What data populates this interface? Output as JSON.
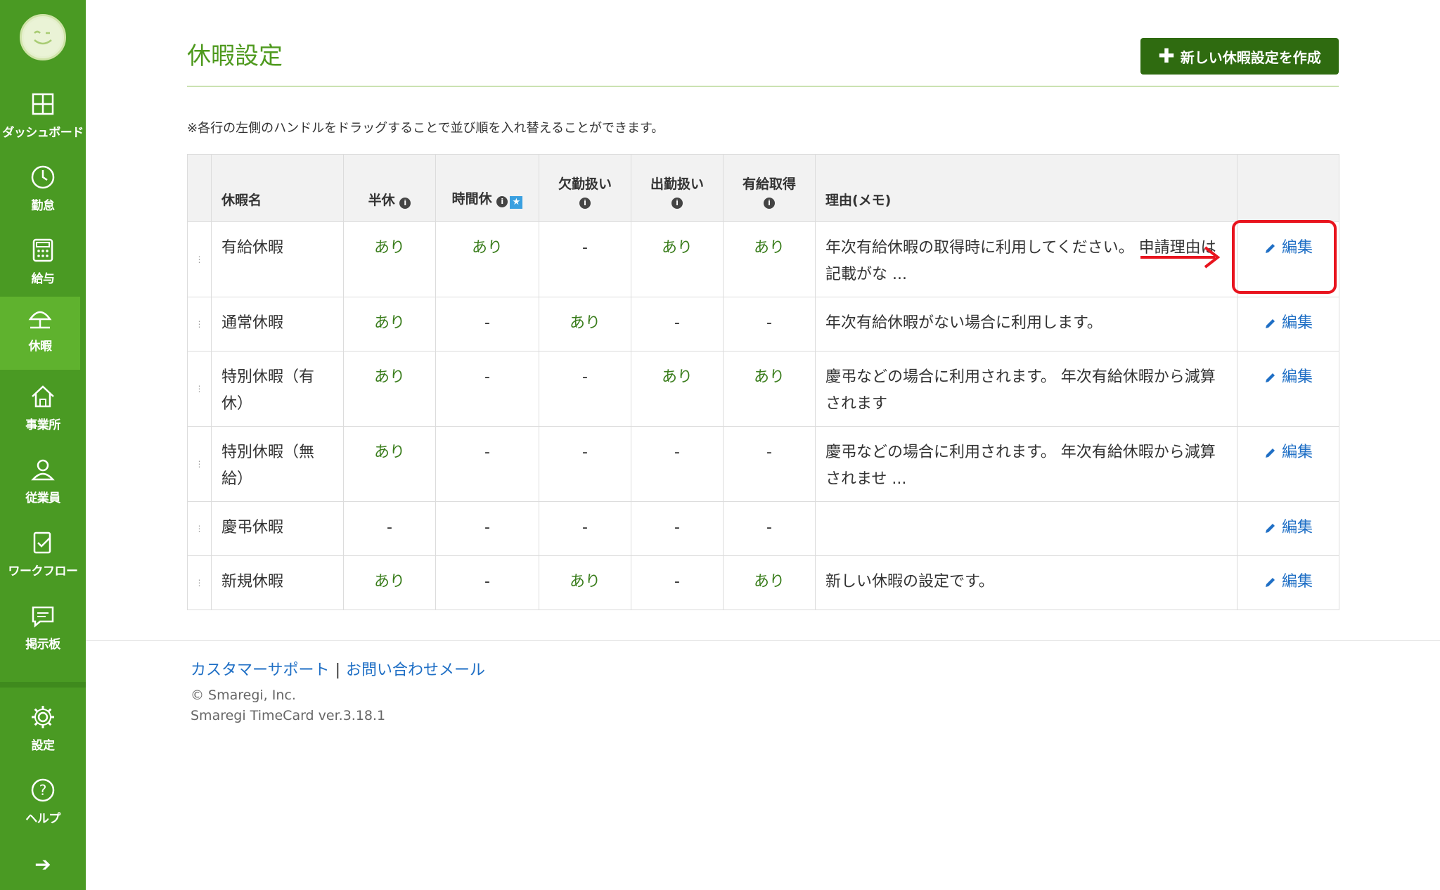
{
  "sidebar": {
    "items": [
      {
        "label": "ダッシュボード",
        "icon": "dashboard-icon"
      },
      {
        "label": "勤怠",
        "icon": "clock-icon"
      },
      {
        "label": "給与",
        "icon": "calculator-icon"
      },
      {
        "label": "休暇",
        "icon": "umbrella-icon",
        "active": true
      },
      {
        "label": "事業所",
        "icon": "home-icon"
      },
      {
        "label": "従業員",
        "icon": "person-icon"
      },
      {
        "label": "ワークフロー",
        "icon": "clipboard-check-icon"
      },
      {
        "label": "掲示板",
        "icon": "message-icon"
      },
      {
        "label": "設定",
        "icon": "gear-icon"
      },
      {
        "label": "ヘルプ",
        "icon": "question-icon"
      }
    ],
    "collapse_icon": "arrow-right-icon",
    "colors": {
      "bg": "#4a9a23",
      "active": "#5fb22e"
    }
  },
  "header": {
    "title": "休暇設定",
    "create_button": "新しい休暇設定を作成"
  },
  "note": "※各行の左側のハンドルをドラッグすることで並び順を入れ替えることができます。",
  "table": {
    "headers": {
      "name": "休暇名",
      "half": "半休",
      "hourly": "時間休",
      "absence": "欠勤扱い",
      "attendance": "出勤扱い",
      "paid": "有給取得",
      "memo": "理由(メモ)"
    },
    "edit_label": "編集",
    "rows": [
      {
        "name": "有給休暇",
        "half": "あり",
        "hourly": "あり",
        "absence": "-",
        "attendance": "あり",
        "paid": "あり",
        "memo": "年次有給休暇の取得時に利用してください。 申請理由は記載がな ..."
      },
      {
        "name": "通常休暇",
        "half": "あり",
        "hourly": "-",
        "absence": "あり",
        "attendance": "-",
        "paid": "-",
        "memo": "年次有給休暇がない場合に利用します。"
      },
      {
        "name": "特別休暇（有休）",
        "half": "あり",
        "hourly": "-",
        "absence": "-",
        "attendance": "あり",
        "paid": "あり",
        "memo": "慶弔などの場合に利用されます。 年次有給休暇から減算されます"
      },
      {
        "name": "特別休暇（無給）",
        "half": "あり",
        "hourly": "-",
        "absence": "-",
        "attendance": "-",
        "paid": "-",
        "memo": "慶弔などの場合に利用されます。 年次有給休暇から減算されませ ..."
      },
      {
        "name": "慶弔休暇",
        "half": "-",
        "hourly": "-",
        "absence": "-",
        "attendance": "-",
        "paid": "-",
        "memo": ""
      },
      {
        "name": "新規休暇",
        "half": "あり",
        "hourly": "-",
        "absence": "あり",
        "attendance": "-",
        "paid": "あり",
        "memo": "新しい休暇の設定です。"
      }
    ]
  },
  "footer": {
    "support_link": "カスタマーサポート",
    "separator": "|",
    "contact_link": "お問い合わせメール",
    "copyright": "© Smaregi, Inc.",
    "version": "Smaregi TimeCard ver.3.18.1"
  },
  "colors": {
    "title": "#4f9a1f",
    "create_button": "#2f6b10",
    "flag_text": "#3a7d1c",
    "link": "#1f6fc5",
    "highlight": "#e8141e"
  }
}
